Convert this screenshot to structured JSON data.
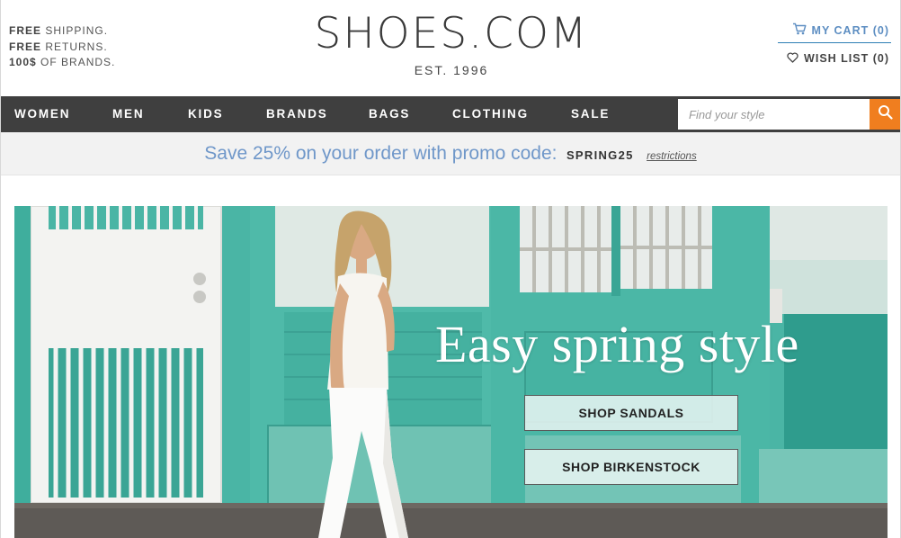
{
  "header": {
    "promo_lines": [
      {
        "bold": "FREE",
        "rest": " SHIPPING."
      },
      {
        "bold": "FREE",
        "rest": " RETURNS."
      },
      {
        "bold": "100$",
        "rest": " OF BRANDS."
      }
    ],
    "logo": "SHOES.COM",
    "established": "EST. 1996",
    "cart_label": "MY CART (0)",
    "wish_label": "WISH LIST (0)",
    "cart_color": "#5d8ec2",
    "divider_color": "#2d7fb5"
  },
  "nav": {
    "items": [
      "WOMEN",
      "MEN",
      "KIDS",
      "BRANDS",
      "BAGS",
      "CLOTHING",
      "SALE"
    ],
    "background": "#3f3f3f",
    "search_placeholder": "Find your style",
    "search_button_color": "#f07e1f"
  },
  "promo": {
    "text": "Save 25% on your order with promo code:",
    "code": "SPRING25",
    "restrictions": "restrictions"
  },
  "hero": {
    "title": "Easy spring style",
    "buttons": [
      "SHOP SANDALS",
      "SHOP BIRKENSTOCK"
    ],
    "wall_color": "#46b3a3"
  }
}
